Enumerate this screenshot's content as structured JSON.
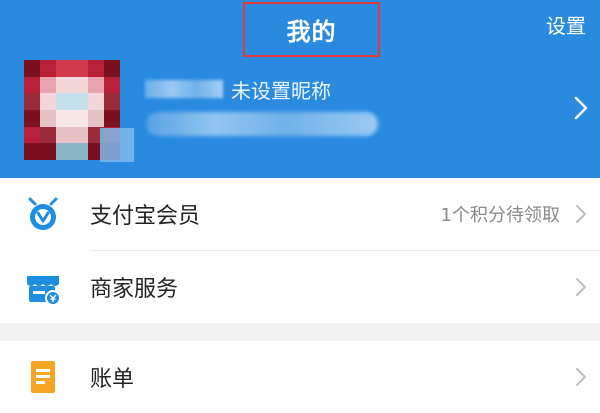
{
  "header": {
    "title": "我的",
    "settings_label": "设置",
    "nickname_visible_text": "未设置昵称",
    "accent_color": "#2a8ae0",
    "highlight_color": "#e03a3a"
  },
  "menu": {
    "items": [
      {
        "label": "支付宝会员",
        "extra": "1个积分待领取",
        "icon": "alipay-member-icon"
      },
      {
        "label": "商家服务",
        "extra": "",
        "icon": "merchant-store-icon"
      },
      {
        "label": "账单",
        "extra": "",
        "icon": "bill-document-icon"
      }
    ]
  },
  "icons": {
    "chevron": "chevron-right-icon",
    "avatar": "avatar-image"
  }
}
